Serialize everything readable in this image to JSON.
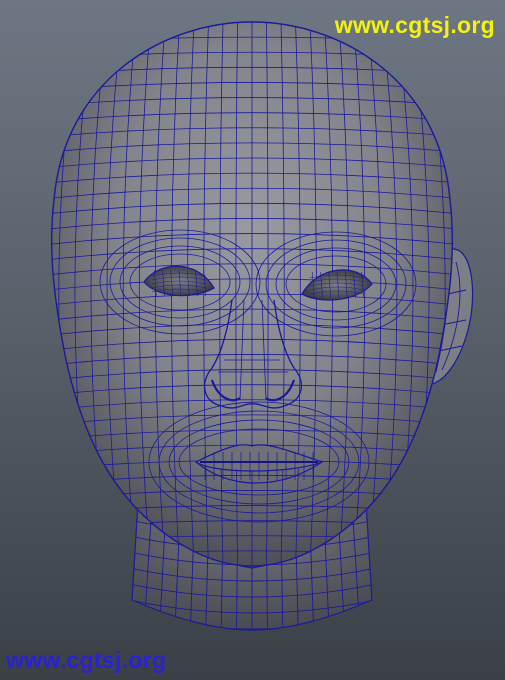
{
  "scene": {
    "subject": "wireframe-head-model",
    "colors": {
      "background_top": "#6d7783",
      "background_bottom": "#3b4047",
      "skin": "#8d8e95",
      "skin_shadow": "#55565d",
      "wire": "#1a1a9a"
    }
  },
  "watermarks": {
    "top_right": {
      "text": "www.cgtsj.org",
      "color": "#f4f20e"
    },
    "bottom_left": {
      "text": "www.cgtsj.org",
      "color": "#2a20d6"
    }
  }
}
